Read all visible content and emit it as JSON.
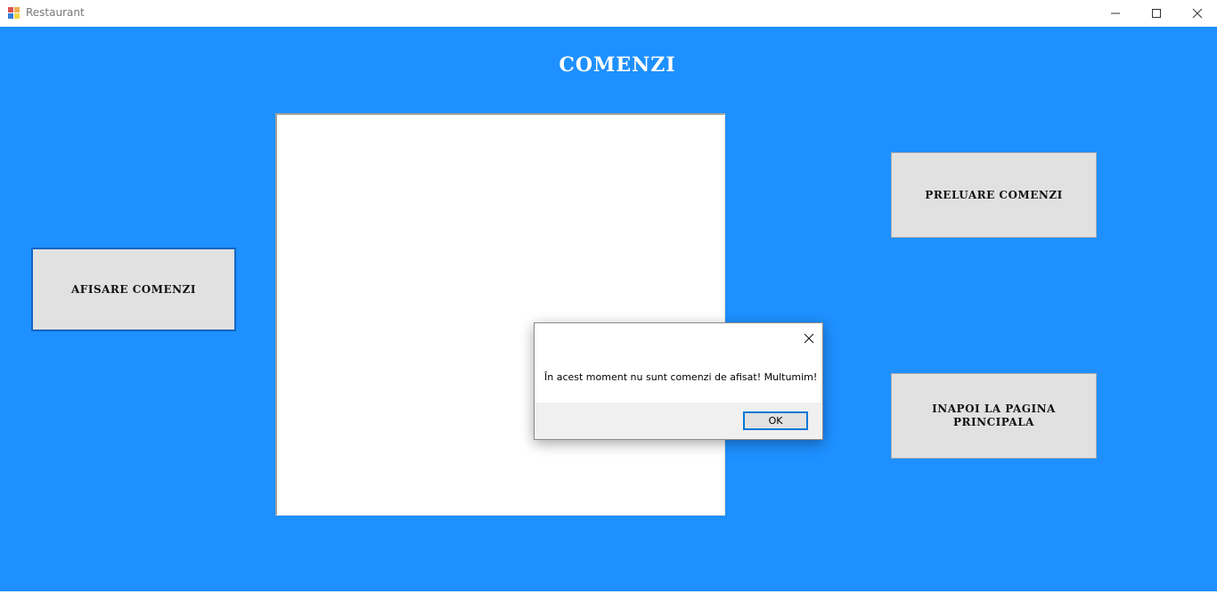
{
  "window": {
    "title": "Restaurant",
    "controls": [
      "minimize-icon",
      "maximize-icon",
      "close-icon"
    ]
  },
  "form": {
    "background_color": "#1e90ff",
    "heading": "COMENZI",
    "buttons": {
      "afisare": "AFISARE COMENZI",
      "preluare": "PRELUARE COMENZI",
      "inapoi": "INAPOI LA PAGINA PRINCIPALA"
    },
    "listbox_items": []
  },
  "message_box": {
    "text": "În acest moment nu sunt comenzi de afisat! Multumim!",
    "ok_label": "OK"
  }
}
